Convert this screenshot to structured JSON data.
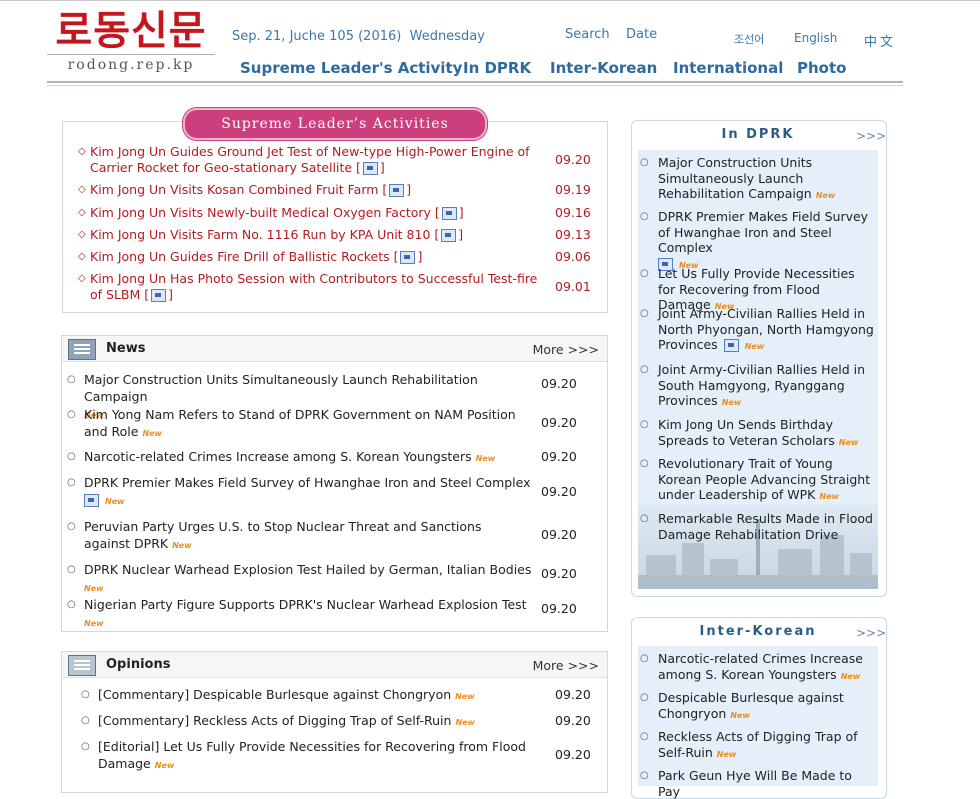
{
  "header": {
    "logo_korean": "로동신문",
    "logo_url": "rodong.rep.kp",
    "date": "Sep. 21, Juche 105 (2016)  Wednesday",
    "search_label": "Search",
    "date_label": "Date",
    "languages": [
      "조선어",
      "English",
      "中文"
    ],
    "nav": [
      "Supreme Leader's Activity",
      "In DPRK",
      "Inter-Korean",
      "International",
      "Photo"
    ]
  },
  "supreme": {
    "title": "Supreme Leader’s Activities",
    "items": [
      {
        "text": "Kim Jong Un Guides Ground Jet Test of New-type High-Power Engine of Carrier Rocket for Geo-stationary Satellite",
        "date": "09.20"
      },
      {
        "text": "Kim Jong Un Visits Kosan Combined Fruit Farm",
        "date": "09.19"
      },
      {
        "text": "Kim Jong Un Visits Newly-built Medical Oxygen Factory",
        "date": "09.16"
      },
      {
        "text": "Kim Jong Un Visits Farm No. 1116 Run by KPA Unit 810",
        "date": "09.13"
      },
      {
        "text": "Kim Jong Un Guides Fire Drill of Ballistic Rockets",
        "date": "09.06"
      },
      {
        "text": "Kim Jong Un Has Photo Session with Contributors to Successful Test-fire of SLBM",
        "date": "09.01"
      }
    ]
  },
  "news": {
    "title": "News",
    "more": "More >>>",
    "items": [
      {
        "text": "Major Construction Units Simultaneously Launch Rehabilitation Campaign",
        "date": "09.20"
      },
      {
        "text": "Kim Yong Nam Refers to Stand of DPRK Government on NAM Position and Role",
        "date": "09.20"
      },
      {
        "text": "Narcotic-related Crimes Increase among S. Korean Youngsters",
        "date": "09.20"
      },
      {
        "text": "DPRK Premier Makes Field Survey of Hwanghae Iron and Steel Complex",
        "date": "09.20"
      },
      {
        "text": "Peruvian Party Urges U.S. to Stop Nuclear Threat and Sanctions against DPRK",
        "date": "09.20"
      },
      {
        "text": "DPRK Nuclear Warhead Explosion Test Hailed by German, Italian Bodies",
        "date": "09.20"
      },
      {
        "text": "Nigerian Party Figure Supports DPRK's Nuclear Warhead Explosion Test",
        "date": "09.20"
      }
    ]
  },
  "opinions": {
    "title": "Opinions",
    "more": "More >>>",
    "items": [
      {
        "text": "[Commentary] Despicable Burlesque against Chongryon",
        "date": "09.20"
      },
      {
        "text": "[Commentary] Reckless Acts of Digging Trap of Self-Ruin",
        "date": "09.20"
      },
      {
        "text": "[Editorial] Let Us Fully Provide Necessities for Recovering from Flood Damage",
        "date": "09.20"
      }
    ]
  },
  "new_badge": "New",
  "in_dprk": {
    "title": "In DPRK",
    "more": ">>>",
    "items": [
      "Major Construction Units Simultaneously Launch Rehabilitation Campaign",
      "DPRK Premier Makes Field Survey of Hwanghae Iron and Steel Complex",
      "Let Us Fully Provide Necessities for Recovering from Flood Damage",
      "Joint Army-Civilian Rallies Held in North Phyongan, North Hamgyong Provinces",
      "Joint Army-Civilian Rallies Held in South Hamgyong, Ryanggang Provinces",
      "Kim Jong Un Sends Birthday Spreads to Veteran Scholars",
      "Revolutionary Trait of Young Korean People Advancing Straight under Leadership of WPK",
      "Remarkable Results Made in Flood Damage Rehabilitation Drive"
    ]
  },
  "inter_korean": {
    "title": "Inter-Korean",
    "more": ">>>",
    "items": [
      "Narcotic-related Crimes Increase among S. Korean Youngsters",
      "Despicable Burlesque against Chongryon",
      "Reckless Acts of Digging Trap of Self-Ruin",
      "Park Geun Hye Will Be Made to Pay"
    ]
  },
  "colors": {
    "accent_red": "#b31b22",
    "nav_blue": "#2c6a9f",
    "title_pink": "#cc3f7d",
    "new_orange": "#f08c1a"
  }
}
